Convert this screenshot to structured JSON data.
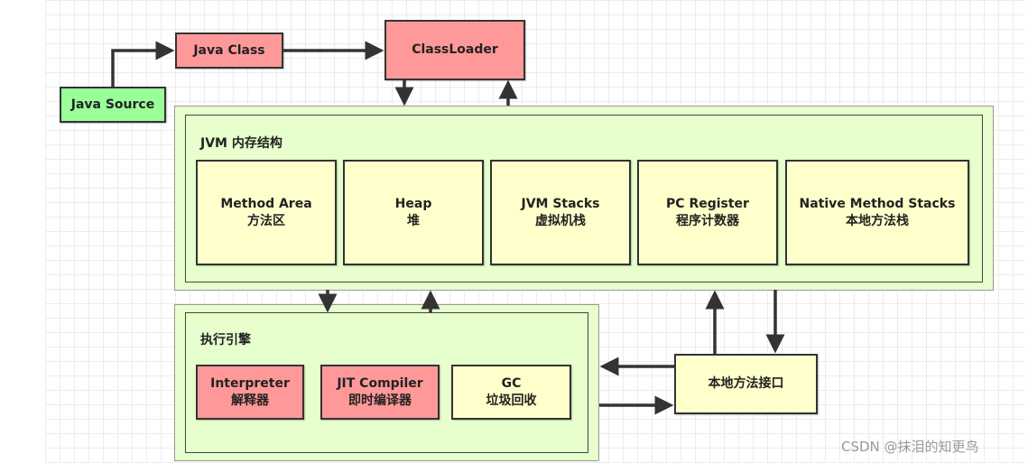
{
  "flow": {
    "java_source": "Java Source",
    "java_class": "Java Class",
    "classloader": "ClassLoader"
  },
  "jvm_memory": {
    "title": "JVM 内存结构",
    "areas": [
      {
        "en": "Method Area",
        "zh": "方法区"
      },
      {
        "en": "Heap",
        "zh": "堆"
      },
      {
        "en": "JVM Stacks",
        "zh": "虚拟机栈"
      },
      {
        "en": "PC Register",
        "zh": "程序计数器"
      },
      {
        "en": "Native Method Stacks",
        "zh": "本地方法栈"
      }
    ]
  },
  "execution_engine": {
    "title": "执行引擎",
    "components": [
      {
        "en": "Interpreter",
        "zh": "解释器"
      },
      {
        "en": "JIT Compiler",
        "zh": "即时编译器"
      },
      {
        "en": "GC",
        "zh": "垃圾回收"
      }
    ]
  },
  "native_interface": "本地方法接口",
  "watermark": "CSDN @抹泪的知更鸟",
  "colors": {
    "red": "#ff9999",
    "green": "#99ff99",
    "yellow": "#ffffcc",
    "container": "#e6ffcc"
  }
}
